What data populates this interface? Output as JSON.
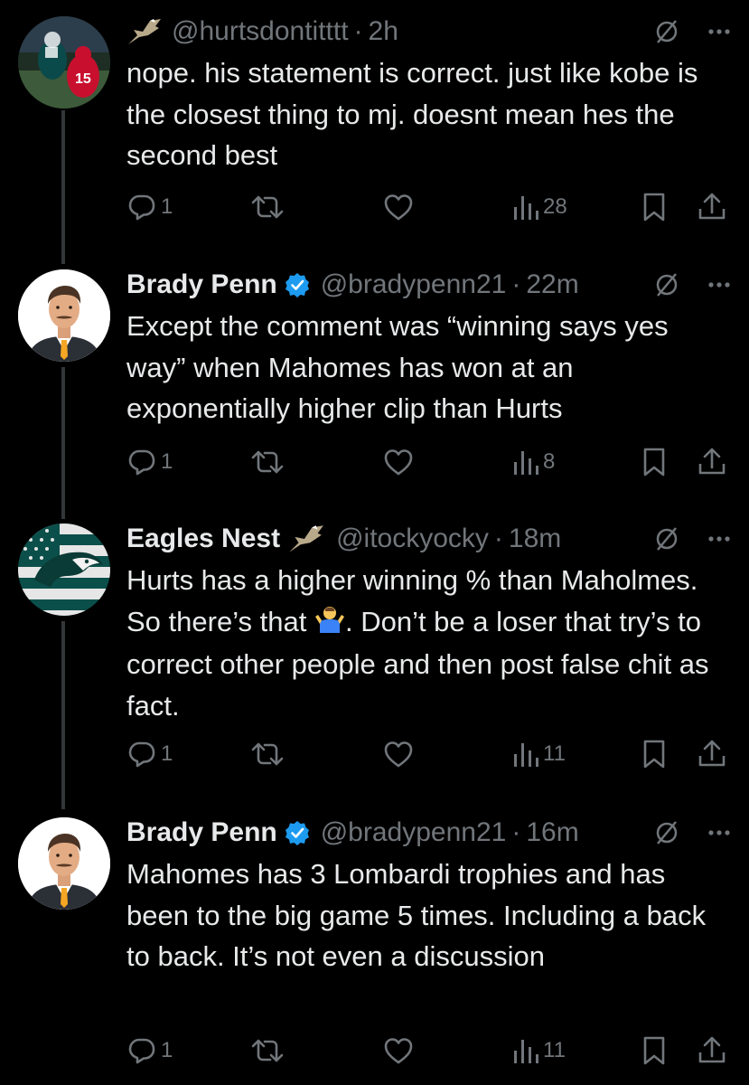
{
  "tweets": [
    {
      "name": "",
      "handle": "@hurtsdontitttt",
      "time": "2h",
      "text": "nope. his statement is correct. just like kobe is the closest thing to mj. doesnt mean hes the second best",
      "replies": "1",
      "views": "28"
    },
    {
      "name": "Brady Penn",
      "handle": "@bradypenn21",
      "time": "22m",
      "text": "Except the comment was “winning says yes way” when Mahomes has won at an exponentially higher clip than Hurts",
      "replies": "1",
      "views": "8"
    },
    {
      "name": "Eagles Nest",
      "handle": "@itockyocky",
      "time": "18m",
      "text_a": "Hurts has a higher winning % than Maholmes.  So there’s that",
      "text_b": ".  Don’t be a loser that try’s to correct other people and then post false chit as fact.",
      "replies": "1",
      "views": "11"
    },
    {
      "name": "Brady Penn",
      "handle": "@bradypenn21",
      "time": "16m",
      "text": "Mahomes has 3 Lombardi trophies and has been to the big game 5 times. Including a back to back. It’s not even a discussion",
      "replies": "1",
      "views": "11"
    }
  ],
  "colors": {
    "background": "#000000",
    "text": "#e7e9ea",
    "muted": "#71767b",
    "verified": "#1d9bf0",
    "thread_line": "#333639"
  },
  "icons": [
    "eagle-icon",
    "grok-icon",
    "more-icon",
    "reply-icon",
    "retweet-icon",
    "like-icon",
    "views-icon",
    "bookmark-icon",
    "share-icon",
    "verified-badge-icon",
    "shrug-emoji-icon"
  ]
}
